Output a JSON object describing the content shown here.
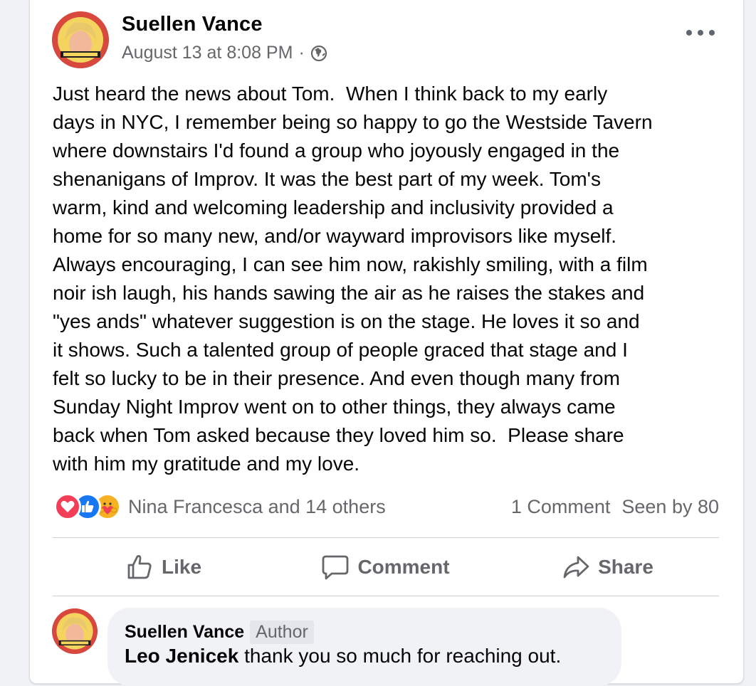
{
  "post": {
    "author": "Suellen Vance",
    "timestamp": "August 13 at 8:08 PM",
    "separator": "·",
    "privacy_icon": "globe-icon",
    "more_icon": "more-options-icon",
    "text": "Just heard the news about Tom.  When I think back to my early\ndays in NYC, I remember being so happy to go the Westside Tavern\nwhere downstairs I'd found a group who joyously engaged in the\nshenanigans of Improv. It was the best part of my week. Tom's\nwarm, kind and welcoming leadership and inclusivity provided a\nhome for so many new, and/or wayward improvisors like myself.\nAlways encouraging, I can see him now, rakishly smiling, with a film\nnoir ish laugh, his hands sawing the air as he raises the stakes and\n\"yes ands\" whatever suggestion is on the stage. He loves it so and\nit shows. Such a talented group of people graced that stage and I\nfelt so lucky to be in their presence. And even though many from\nSunday Night Improv went on to other things, they always came\nback when Tom asked because they loved him so.  Please share\nwith him my gratitude and my love."
  },
  "reactions": {
    "icons": [
      "love-reaction-icon",
      "like-reaction-icon",
      "care-reaction-icon"
    ],
    "names": "Nina Francesca and 14 others",
    "comments": "1 Comment",
    "seen": "Seen by 80"
  },
  "actions": {
    "like": "Like",
    "comment": "Comment",
    "share": "Share"
  },
  "comment": {
    "author": "Suellen Vance",
    "badge": "Author",
    "mention": "Leo Jenicek",
    "text": " thank you so much for reaching out."
  },
  "colors": {
    "text": "#050505",
    "secondary": "#65676b",
    "love": "#f33e58",
    "like": "#1877f2",
    "care": "#f7b125"
  }
}
